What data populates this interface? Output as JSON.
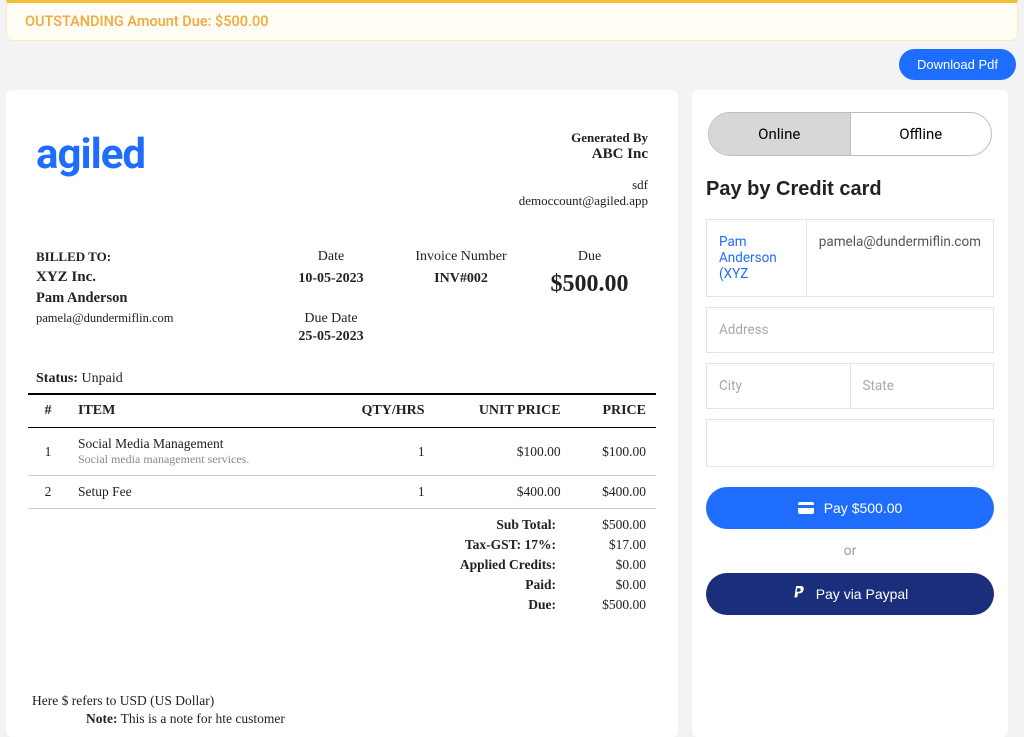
{
  "banner": "OUTSTANDING Amount Due: $500.00",
  "downloadPdf": "Download Pdf",
  "invoice": {
    "logo": "agiled",
    "generated": {
      "label": "Generated By",
      "company": "ABC Inc",
      "sub1": "sdf",
      "sub2": "democcount@agiled.app"
    },
    "bill": {
      "label": "BILLED TO:",
      "client": "XYZ Inc.",
      "person": "Pam  Anderson",
      "email": "pamela@dundermiflin.com"
    },
    "date": {
      "label": "Date",
      "value": "10-05-2023",
      "dueLabel": "Due Date",
      "dueValue": "25-05-2023"
    },
    "invNumber": {
      "label": "Invoice Number",
      "value": "INV#002"
    },
    "due": {
      "label": "Due",
      "value": "$500.00"
    },
    "statusLabel": "Status:",
    "statusValue": "Unpaid",
    "headers": {
      "num": "#",
      "item": "ITEM",
      "qty": "QTY/HRS",
      "unit": "UNIT PRICE",
      "price": "PRICE"
    },
    "items": [
      {
        "n": "1",
        "name": "Social Media Management",
        "desc": "Social media management services.",
        "qty": "1",
        "unit": "$100.00",
        "price": "$100.00"
      },
      {
        "n": "2",
        "name": "Setup Fee",
        "desc": "",
        "qty": "1",
        "unit": "$400.00",
        "price": "$400.00"
      }
    ],
    "totals": [
      {
        "label": "Sub Total:",
        "value": "$500.00"
      },
      {
        "label": "Tax-GST: 17%:",
        "value": "$17.00"
      },
      {
        "label": "Applied Credits:",
        "value": "$0.00"
      },
      {
        "label": "Paid:",
        "value": "$0.00"
      },
      {
        "label": "Due:",
        "value": "$500.00"
      }
    ],
    "footer1": "Here $ refers to USD (US Dollar)",
    "footer2a": "Note:",
    "footer2b": "This is a note for hte customer"
  },
  "sidebar": {
    "tabOnline": "Online",
    "tabOffline": "Offline",
    "header": "Pay by Credit card",
    "nameValue": "Pam Anderson (XYZ",
    "emailValue": "pamela@dundermiflin.com",
    "addressPlaceholder": "Address",
    "cityPlaceholder": "City",
    "statePlaceholder": "State",
    "payLabel": "Pay $500.00",
    "or": "or",
    "paypalLabel": "Pay via Paypal"
  }
}
